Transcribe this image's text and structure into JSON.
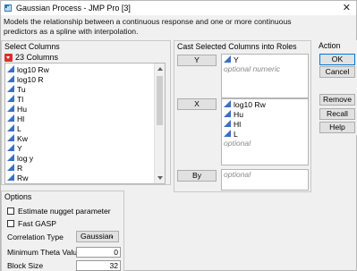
{
  "window": {
    "title": "Gaussian Process - JMP Pro [3]",
    "close": "✕",
    "description": "Models the relationship between a continuous response and one or more continuous predictors as a spline with interpolation."
  },
  "select_columns": {
    "title": "Select Columns",
    "count": "23 Columns",
    "columns": [
      "log10 Rw",
      "log10 R",
      "Tu",
      "Tl",
      "Hu",
      "Hl",
      "L",
      "Kw",
      "Y",
      "log y",
      "R",
      "Rw"
    ]
  },
  "cast": {
    "title": "Cast Selected Columns into Roles",
    "roles": {
      "y": {
        "button": "Y",
        "items": [
          "Y"
        ],
        "hint": "optional numeric"
      },
      "x": {
        "button": "X",
        "items": [
          "log10 Rw",
          "Hu",
          "Hl",
          "L"
        ],
        "hint": "optional"
      },
      "by": {
        "button": "By",
        "hint": "optional"
      }
    }
  },
  "action": {
    "title": "Action",
    "ok": "OK",
    "cancel": "Cancel",
    "remove": "Remove",
    "recall": "Recall",
    "help": "Help"
  },
  "options": {
    "title": "Options",
    "estimate_nugget": "Estimate nugget parameter",
    "fast_gasp": "Fast GASP",
    "correlation_type_label": "Correlation Type",
    "correlation_type_value": "Gaussian",
    "min_theta_label": "Minimum Theta Value",
    "min_theta_value": "0",
    "block_size_label": "Block Size",
    "block_size_value": "32"
  },
  "colors": {
    "continuous_icon": "#3b6fc4",
    "red_menu": "#d9322b",
    "default_button_border": "#0078d7"
  }
}
